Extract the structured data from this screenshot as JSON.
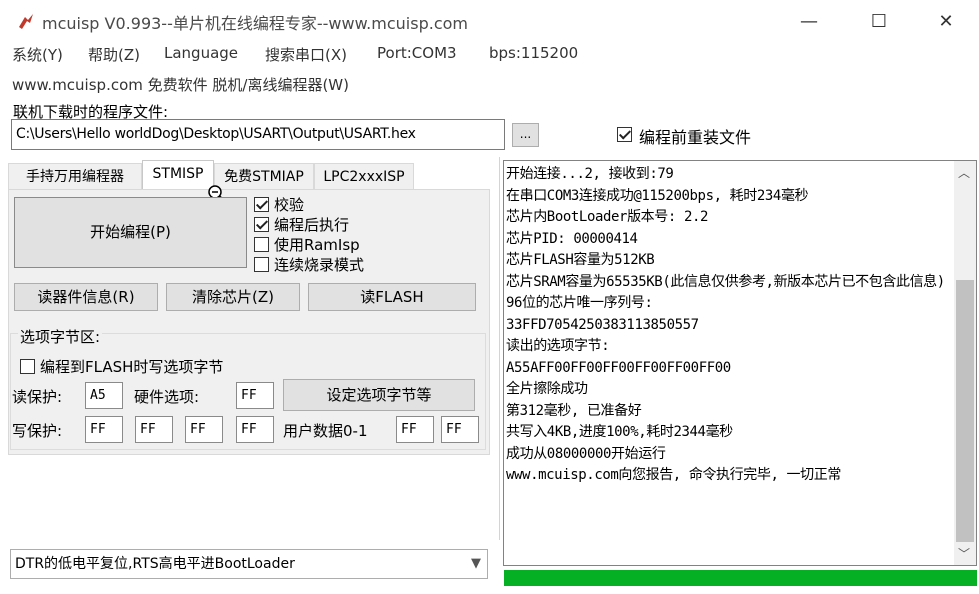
{
  "window": {
    "title": "mcuisp V0.993--单片机在线编程专家--www.mcuisp.com",
    "minimize": "—",
    "maximize": "☐",
    "close": "✕"
  },
  "menu": {
    "items": [
      "系统(Y)",
      "帮助(Z)",
      "Language",
      "搜索串口(X)",
      "Port:COM3",
      "bps:115200"
    ]
  },
  "subtitle": "www.mcuisp.com 免费软件 脱机/离线编程器(W)",
  "file": {
    "group_label": "联机下载时的程序文件:",
    "path": "C:\\Users\\Hello worldDog\\Desktop\\USART\\Output\\USART.hex",
    "browse_label": "...",
    "reload_label": "编程前重装文件",
    "reload_checked": true
  },
  "tabs": [
    {
      "label": "手持万用编程器",
      "active": false
    },
    {
      "label": "STMISP",
      "active": true
    },
    {
      "label": "免费STMIAP",
      "active": false
    },
    {
      "label": "LPC2xxxISP",
      "active": false
    }
  ],
  "stmisp": {
    "start_label": "开始编程(P)",
    "options": [
      {
        "label": "校验",
        "checked": true
      },
      {
        "label": "编程后执行",
        "checked": true
      },
      {
        "label": "使用RamIsp",
        "checked": false
      },
      {
        "label": "连续烧录模式",
        "checked": false
      }
    ],
    "read_info_label": "读器件信息(R)",
    "erase_label": "清除芯片(Z)",
    "read_flash_label": "读FLASH",
    "option_bytes": {
      "group_label": "选项字节区:",
      "write_to_flash_label": "编程到FLASH时写选项字节",
      "write_to_flash_checked": false,
      "read_protect_label": "读保护:",
      "read_protect_value": "A5",
      "hw_option_label": "硬件选项:",
      "hw_option_value": "FF",
      "set_button_label": "设定选项字节等",
      "write_protect_label": "写保护:",
      "write_protect_values": [
        "FF",
        "FF",
        "FF",
        "FF"
      ],
      "user_data_label": "用户数据0-1",
      "user_data_values": [
        "FF",
        "FF"
      ]
    }
  },
  "status_select": {
    "value": "DTR的低电平复位,RTS高电平进BootLoader"
  },
  "log": {
    "lines": "开始连接...2, 接收到:79\n在串口COM3连接成功@115200bps, 耗时234毫秒\n芯片内BootLoader版本号: 2.2\n芯片PID: 00000414\n芯片FLASH容量为512KB\n芯片SRAM容量为65535KB(此信息仅供参考,新版本芯片已不包含此信息)\n96位的芯片唯一序列号:\n33FFD7054250383113850557\n读出的选项字节:\nA55AFF00FF00FF00FF00FF00FF00\n全片擦除成功\n第312毫秒, 已准备好\n共写入4KB,进度100%,耗时2344毫秒\n成功从08000000开始运行\nwww.mcuisp.com向您报告, 命令执行完毕, 一切正常",
    "scroll_up": "︿",
    "scroll_down": "﹀"
  },
  "progress": {
    "fraction": 1.0,
    "color": "#06b025"
  },
  "colors": {
    "accent": "#06b025",
    "title_icon": "#c0392b"
  }
}
